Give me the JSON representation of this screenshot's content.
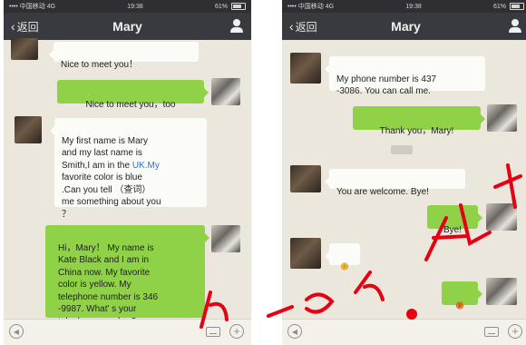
{
  "status_bar": {
    "carrier": "•••• 中国移动 4G",
    "time": "19:38",
    "battery": "61%"
  },
  "nav": {
    "back_label": "返回",
    "title": "Mary"
  },
  "left_messages": [
    {
      "text": "Nice to meet you！"
    },
    {
      "text": "Nice to meet you，too"
    },
    {
      "text_before": "My first name is Mary\nand my last name is\nSmith,I am in the ",
      "link": "UK.My",
      "text_after": "\nfavorite color is blue\n.Can you tell （查词）\nme something about you\n？"
    },
    {
      "text": "Hi，Mary！ My name is\nKate Black and I am in\nChina now. My favorite\ncolor is yellow. My\ntelephone number is 346\n-9987. What' s your\ntelephone number?"
    }
  ],
  "right_messages": [
    {
      "text": "My phone number is 437\n-3086. You can call me."
    },
    {
      "text": "Thank you，Mary!"
    },
    {
      "text": "You are welcome. Bye!"
    },
    {
      "text": "Bye!"
    },
    {
      "emoji": "◉"
    },
    {
      "emoji": "◉"
    }
  ],
  "input_bar": {
    "voice_icon": "voice-icon",
    "keyboard_icon": "keyboard-icon",
    "plus_icon": "plus-icon"
  },
  "colors": {
    "nav_bg": "#393a3f",
    "chat_bg": "#ebe7dc",
    "bubble_in": "#fbfbf8",
    "bubble_out": "#8fd248",
    "link": "#2a73c9",
    "watermark": "#e60012"
  }
}
